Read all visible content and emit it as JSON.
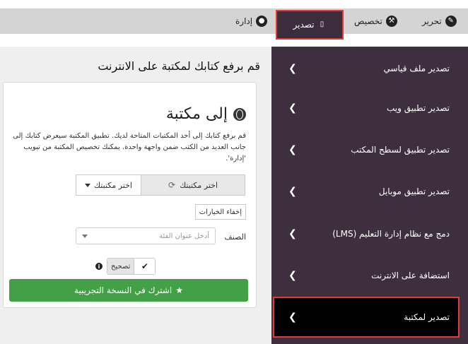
{
  "topbar": {
    "tabs": [
      {
        "label": "تحرير",
        "icon": "pencil-icon"
      },
      {
        "label": "تخصيص",
        "icon": "wrench-icon"
      },
      {
        "label": "تصدير",
        "icon": "mobile-icon"
      },
      {
        "label": "إدارة",
        "icon": "user-icon"
      }
    ]
  },
  "main": {
    "heading": "قم برفع كتابك لمكتبة على الانترنت",
    "card": {
      "title": "إلى مكتبة",
      "title_icon": "globe-icon",
      "description": "قم برفع كتابك إلى أحد المكتبات المتاحة لديك. تطبيق المكتبة سيعرض كتابك إلى جانب العديد من الكتب ضمن واجهة واحدة. يمكنك تخصيص المكتبة من تبويب 'إدارة'.",
      "choose_library_button": "اختر مكتبتك",
      "choose_library_dropdown": "اختر مكتبتك",
      "hide_options": "إخفاء الخيارات",
      "category_label": "الصنف",
      "category_placeholder": "أدخل عنوان الفئة",
      "fix_label": "تصحيح",
      "trial_button": "اشترك في النسخة التجريبية"
    }
  },
  "sidebar": {
    "items": [
      {
        "label": "تصدير ملف قياسي"
      },
      {
        "label": "تصدير تطبيق ويب"
      },
      {
        "label": "تصدير تطبيق لسطح المكتب"
      },
      {
        "label": "تصدير تطبيق موبايل"
      },
      {
        "label": "دمج مع نظام إدارة التعليم (LMS)"
      },
      {
        "label": "استضافة على الانترنت"
      },
      {
        "label": "تصدير لمكتبة",
        "active": true
      }
    ]
  },
  "colors": {
    "sidebar_bg": "#3e2f3f",
    "active_item_bg": "#000000",
    "highlight_border": "#e53935",
    "trial_button": "#43a047"
  }
}
